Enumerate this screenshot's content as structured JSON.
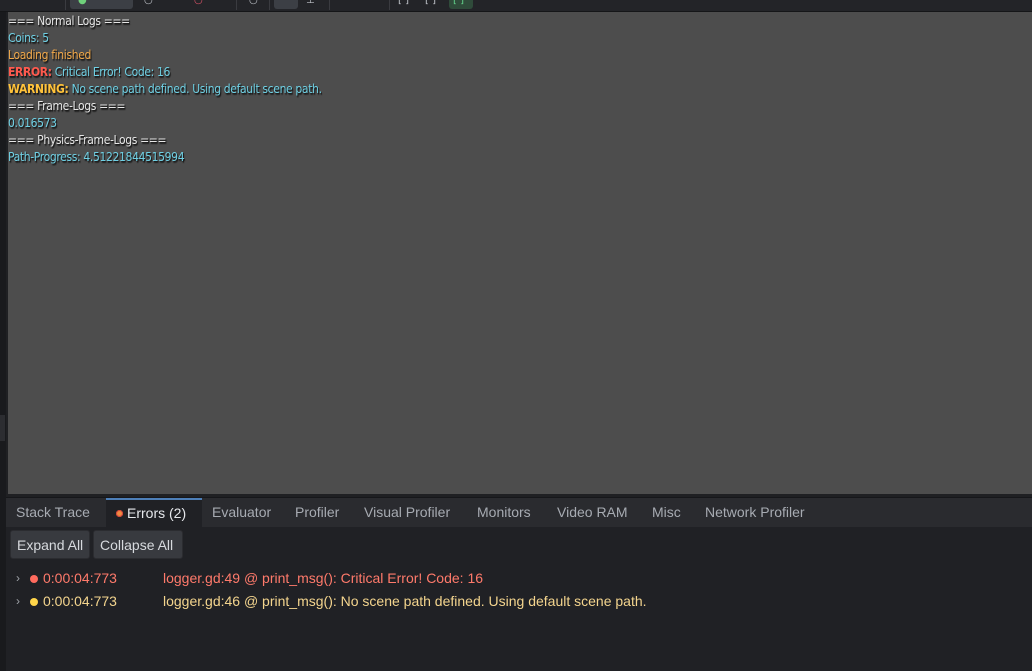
{
  "colors": {
    "viewport_bg": "#4d4d4d",
    "panel_bg": "#202125",
    "error": "#ff7a6b",
    "warning": "#f4d58e",
    "accent": "#4d7fb8"
  },
  "viewport": {
    "lines": [
      {
        "parts": [
          {
            "text": "=== Normal Logs ===",
            "color": "white"
          }
        ]
      },
      {
        "parts": [
          {
            "text": "Coins: 5",
            "color": "cyan"
          }
        ]
      },
      {
        "parts": [
          {
            "text": "Loading finished",
            "color": "orange"
          }
        ]
      },
      {
        "parts": [
          {
            "text": "ERROR:",
            "color": "red"
          },
          {
            "text": " Critical Error! Code: 16",
            "color": "cyan"
          }
        ]
      },
      {
        "parts": [
          {
            "text": "WARNING:",
            "color": "yellow"
          },
          {
            "text": " No scene path defined. Using default scene path.",
            "color": "cyan"
          }
        ]
      },
      {
        "parts": [
          {
            "text": "=== Frame-Logs ===",
            "color": "white"
          }
        ]
      },
      {
        "parts": [
          {
            "text": "0.016573",
            "color": "cyan"
          }
        ]
      },
      {
        "parts": [
          {
            "text": "=== Physics-Frame-Logs ===",
            "color": "white"
          }
        ]
      },
      {
        "parts": [
          {
            "text": "Path-Progress: 4.51221844515994",
            "color": "cyan"
          }
        ]
      }
    ]
  },
  "debugger": {
    "tabs": [
      {
        "label": "Stack Trace",
        "active": false
      },
      {
        "label": "Errors (2)",
        "active": true
      },
      {
        "label": "Evaluator",
        "active": false
      },
      {
        "label": "Profiler",
        "active": false
      },
      {
        "label": "Visual Profiler",
        "active": false
      },
      {
        "label": "Monitors",
        "active": false
      },
      {
        "label": "Video RAM",
        "active": false
      },
      {
        "label": "Misc",
        "active": false
      },
      {
        "label": "Network Profiler",
        "active": false
      }
    ],
    "expand_all": "Expand All",
    "collapse_all": "Collapse All",
    "errors": [
      {
        "icon": "error-icon",
        "time": "0:00:04:773",
        "message": "logger.gd:49 @ print_msg(): Critical Error! Code: 16",
        "severity": "error"
      },
      {
        "icon": "warning-icon",
        "time": "0:00:04:773",
        "message": "logger.gd:46 @ print_msg(): No scene path defined. Using default scene path.",
        "severity": "warning"
      }
    ]
  }
}
